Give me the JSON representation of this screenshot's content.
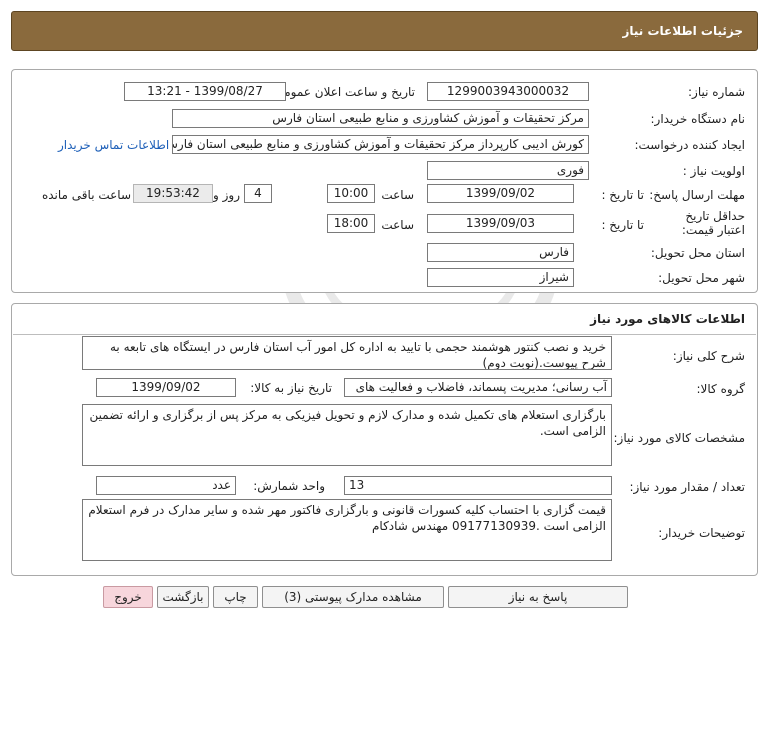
{
  "header": {
    "title": "جزئیات اطلاعات نیاز"
  },
  "info": {
    "need_number_label": "شماره نیاز:",
    "need_number": "1299003943000032",
    "announce_label": "تاریخ و ساعت اعلان عمومی:",
    "announce_value": "1399/08/27 - 13:21",
    "buyer_label": "نام دستگاه خریدار:",
    "buyer_value": "مرکز تحقیقات و آموزش کشاورزی و منابع طبیعی استان فارس",
    "creator_label": "ایجاد کننده درخواست:",
    "creator_value": "کورش ادیبی کارپرداز مرکز تحقیقات و آموزش کشاورزی و منابع طبیعی استان فارس",
    "contact_link": "اطلاعات تماس خریدار",
    "priority_label": "اولویت نیاز :",
    "priority_value": "فوری",
    "reply_deadline_label": "مهلت ارسال پاسخ:",
    "until_date_label": "تا تاریخ :",
    "reply_date": "1399/09/02",
    "time_label": "ساعت",
    "reply_time": "10:00",
    "days_value": "4",
    "days_label": "روز و",
    "remaining_time": "19:53:42",
    "remaining_label": "ساعت باقی مانده",
    "price_validity_label": "حداقل تاریخ اعتبار قیمت:",
    "price_until_label": "تا تاریخ :",
    "price_date": "1399/09/03",
    "price_time_label": "ساعت",
    "price_time": "18:00",
    "province_label": "استان محل تحویل:",
    "province_value": "فارس",
    "city_label": "شهر محل تحویل:",
    "city_value": "شیراز"
  },
  "goods": {
    "section_title": "اطلاعات کالاهای مورد نیاز",
    "summary_label": "شرح کلی نیاز:",
    "summary_value": "خرید و نصب کنتور هوشمند حجمی با تایید به اداره کل امور آب استان فارس در ایستگاه های تابعه به شرح پیوست.(نوبت دوم)",
    "group_label": "گروه کالا:",
    "group_value": "آب رسانی؛ مدیریت پسماند، فاضلاب و فعالیت های",
    "need_date_label": "تاریخ نیاز به کالا:",
    "need_date": "1399/09/02",
    "specs_label": "مشخصات کالای مورد نیاز:",
    "specs_value": "بارگزاری استعلام های تکمیل شده و مدارک لازم و تحویل فیزیکی به مرکز پس از برگزاری و ارائه تضمین الزامی است.",
    "quantity_label": "تعداد / مقدار مورد نیاز:",
    "quantity_value": "13",
    "unit_label": "واحد شمارش:",
    "unit_value": "عدد",
    "buyer_notes_label": "توضیحات خریدار:",
    "buyer_notes_value": "قیمت گزاری با احتساب کلیه کسورات قانونی و بارگزاری فاکتور مهر شده و سایر مدارک در فرم استعلام الزامی است .09177130939 مهندس شادکام"
  },
  "actions": {
    "reply": "پاسخ به نیاز",
    "attachments": "مشاهده مدارک پیوستی (3)",
    "print": "چاپ",
    "back": "بازگشت",
    "exit": "خروج"
  },
  "colors": {
    "header_bg": "#8a6a3d",
    "exit_bg": "#f7d6dc",
    "link": "#1d5fb8"
  }
}
